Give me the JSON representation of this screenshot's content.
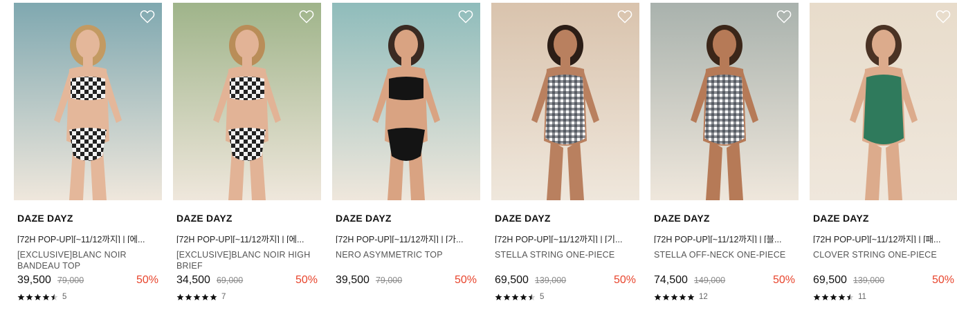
{
  "products": [
    {
      "brand": "DAZE DAYZ",
      "promo": "[72H POP-UP][~11/12까지] | [에...",
      "name": "[EXCLUSIVE]BLANC NOIR BANDEAU TOP",
      "price": "39,500",
      "original_price": "79,000",
      "discount": "50%",
      "rating": 4.5,
      "review_count": "5",
      "image": {
        "bg": "#7fa8b0",
        "skin": "#e4b79a",
        "hair": "#c39a62",
        "suit": "checker",
        "suit_color": "#222222"
      }
    },
    {
      "brand": "DAZE DAYZ",
      "promo": "[72H POP-UP][~11/12까지] | [에...",
      "name": "[EXCLUSIVE]BLANC NOIR HIGH BRIEF",
      "price": "34,500",
      "original_price": "69,000",
      "discount": "50%",
      "rating": 5,
      "review_count": "7",
      "image": {
        "bg": "#9fb48a",
        "skin": "#e2b396",
        "hair": "#b98d58",
        "suit": "checker",
        "suit_color": "#222222"
      }
    },
    {
      "brand": "DAZE DAYZ",
      "promo": "[72H POP-UP][~11/12까지] | [가...",
      "name": "NERO ASYMMETRIC TOP",
      "price": "39,500",
      "original_price": "79,000",
      "discount": "50%",
      "rating": 0,
      "review_count": "",
      "image": {
        "bg": "#8fbcbb",
        "skin": "#d9a382",
        "hair": "#3a2a22",
        "suit": "solid",
        "suit_color": "#141414"
      }
    },
    {
      "brand": "DAZE DAYZ",
      "promo": "[72H POP-UP][~11/12까지] | [기...",
      "name": "STELLA STRING ONE-PIECE",
      "price": "69,500",
      "original_price": "139,000",
      "discount": "50%",
      "rating": 4.5,
      "review_count": "5",
      "image": {
        "bg": "#d9c3ad",
        "skin": "#b9805f",
        "hair": "#2b1d16",
        "suit": "gingham",
        "suit_color": "#2a2f3a"
      }
    },
    {
      "brand": "DAZE DAYZ",
      "promo": "[72H POP-UP][~11/12까지] | [블...",
      "name": "STELLA OFF-NECK ONE-PIECE",
      "price": "74,500",
      "original_price": "149,000",
      "discount": "50%",
      "rating": 5,
      "review_count": "12",
      "image": {
        "bg": "#a9b2ad",
        "skin": "#b67a57",
        "hair": "#3b2619",
        "suit": "gingham",
        "suit_color": "#2a2f3a"
      }
    },
    {
      "brand": "DAZE DAYZ",
      "promo": "[72H POP-UP][~11/12까지] | [패...",
      "name": "CLOVER STRING ONE-PIECE",
      "price": "69,500",
      "original_price": "139,000",
      "discount": "50%",
      "rating": 4.5,
      "review_count": "11",
      "image": {
        "bg": "#e8dccb",
        "skin": "#dcab8c",
        "hair": "#4a3224",
        "suit": "solid",
        "suit_color": "#2f7a5c"
      }
    }
  ],
  "icons": {
    "wishlist": "heart-outline-icon",
    "star": "star-icon"
  },
  "colors": {
    "discount": "#e8442c",
    "price": "#111111",
    "original_price": "#888888"
  }
}
